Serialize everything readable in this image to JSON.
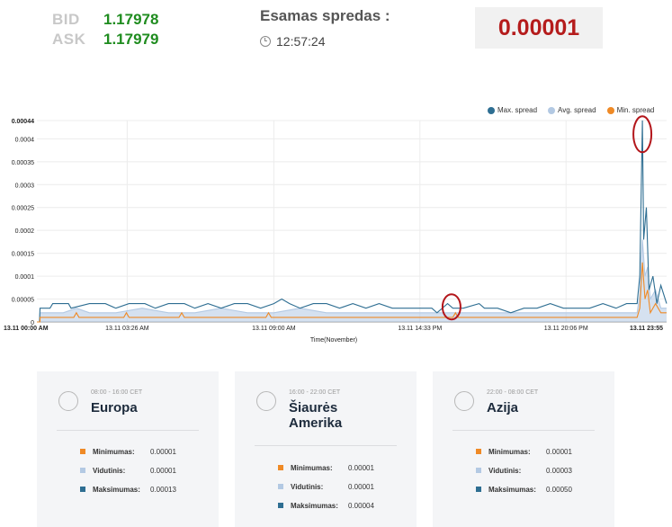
{
  "quotes": {
    "bid_label": "BID",
    "bid_value": "1.17978",
    "ask_label": "ASK",
    "ask_value": "1.17979"
  },
  "current_spread": {
    "title": "Esamas spredas :",
    "time": "12:57:24",
    "value": "0.00001",
    "icon": "clock-icon"
  },
  "colors": {
    "max": "#2e6e92",
    "avg": "#b3c9e3",
    "min": "#ef8a26",
    "highlight": "#b3161b"
  },
  "chart_data": {
    "type": "line",
    "xlabel": "Time(November)",
    "ylabel": "",
    "ylim": [
      0,
      0.00044
    ],
    "yticks": [
      "0.00044",
      "0.0004",
      "0.00035",
      "0.0003",
      "0.00025",
      "0.0002",
      "0.00015",
      "0.0001",
      "0.00005",
      "0"
    ],
    "xticks": [
      "13.11 00:00 AM",
      "13.11 03:26 AM",
      "13.11 09:00 AM",
      "13.11 14:33 PM",
      "13.11 20:06 PM",
      "13.11 23:55"
    ],
    "legend_position": "top-right",
    "grid": true,
    "x_range_hours": [
      0,
      23.92
    ],
    "series": [
      {
        "name": "Max. spread",
        "points": [
          [
            0,
            0
          ],
          [
            0.1,
            0
          ],
          [
            0.12,
            3e-05
          ],
          [
            0.5,
            3e-05
          ],
          [
            0.6,
            4e-05
          ],
          [
            1.2,
            4e-05
          ],
          [
            1.3,
            3e-05
          ],
          [
            2.0,
            4e-05
          ],
          [
            2.6,
            4e-05
          ],
          [
            3.0,
            3e-05
          ],
          [
            3.5,
            4e-05
          ],
          [
            4.1,
            4e-05
          ],
          [
            4.5,
            3e-05
          ],
          [
            5.0,
            4e-05
          ],
          [
            5.6,
            4e-05
          ],
          [
            6.0,
            3e-05
          ],
          [
            6.5,
            4e-05
          ],
          [
            7.0,
            3e-05
          ],
          [
            7.5,
            4e-05
          ],
          [
            8.0,
            4e-05
          ],
          [
            8.5,
            3e-05
          ],
          [
            9.0,
            4e-05
          ],
          [
            9.3,
            5e-05
          ],
          [
            9.6,
            4e-05
          ],
          [
            10.0,
            3e-05
          ],
          [
            10.5,
            4e-05
          ],
          [
            11.0,
            4e-05
          ],
          [
            11.5,
            3e-05
          ],
          [
            12.0,
            4e-05
          ],
          [
            12.5,
            3e-05
          ],
          [
            13.0,
            4e-05
          ],
          [
            13.5,
            3e-05
          ],
          [
            14.0,
            3e-05
          ],
          [
            14.5,
            3e-05
          ],
          [
            15.0,
            3e-05
          ],
          [
            15.2,
            2e-05
          ],
          [
            15.4,
            3e-05
          ],
          [
            15.6,
            4e-05
          ],
          [
            15.8,
            3e-05
          ],
          [
            16.2,
            3e-05
          ],
          [
            16.8,
            4e-05
          ],
          [
            17.0,
            3e-05
          ],
          [
            17.5,
            3e-05
          ],
          [
            18.0,
            2e-05
          ],
          [
            18.5,
            3e-05
          ],
          [
            19.0,
            3e-05
          ],
          [
            19.5,
            4e-05
          ],
          [
            20.0,
            3e-05
          ],
          [
            20.5,
            3e-05
          ],
          [
            21.0,
            3e-05
          ],
          [
            21.5,
            4e-05
          ],
          [
            22.0,
            3e-05
          ],
          [
            22.4,
            4e-05
          ],
          [
            22.8,
            4e-05
          ],
          [
            22.9,
            0.0001
          ],
          [
            23.0,
            0.00044
          ],
          [
            23.05,
            0.00018
          ],
          [
            23.15,
            0.00025
          ],
          [
            23.25,
            7e-05
          ],
          [
            23.4,
            0.0001
          ],
          [
            23.55,
            4e-05
          ],
          [
            23.7,
            8e-05
          ],
          [
            23.92,
            4e-05
          ]
        ]
      },
      {
        "name": "Avg. spread",
        "points": [
          [
            0,
            0
          ],
          [
            0.1,
            0
          ],
          [
            0.12,
            2e-05
          ],
          [
            1.0,
            2e-05
          ],
          [
            1.5,
            3e-05
          ],
          [
            2.0,
            2e-05
          ],
          [
            3.0,
            2e-05
          ],
          [
            4.0,
            3e-05
          ],
          [
            5.0,
            2e-05
          ],
          [
            6.0,
            2e-05
          ],
          [
            7.0,
            3e-05
          ],
          [
            8.0,
            2e-05
          ],
          [
            9.0,
            2e-05
          ],
          [
            10.0,
            3e-05
          ],
          [
            11.0,
            2e-05
          ],
          [
            12.0,
            2e-05
          ],
          [
            13.0,
            2e-05
          ],
          [
            14.0,
            2e-05
          ],
          [
            15.0,
            2e-05
          ],
          [
            16.0,
            2e-05
          ],
          [
            17.0,
            2e-05
          ],
          [
            18.0,
            2e-05
          ],
          [
            19.0,
            2e-05
          ],
          [
            20.0,
            2e-05
          ],
          [
            21.0,
            2e-05
          ],
          [
            22.0,
            2e-05
          ],
          [
            22.8,
            2e-05
          ],
          [
            22.9,
            6e-05
          ],
          [
            23.0,
            0.00018
          ],
          [
            23.1,
            0.0001
          ],
          [
            23.2,
            0.00012
          ],
          [
            23.3,
            5e-05
          ],
          [
            23.5,
            7e-05
          ],
          [
            23.7,
            3e-05
          ],
          [
            23.92,
            3e-05
          ]
        ]
      },
      {
        "name": "Min. spread",
        "points": [
          [
            0,
            0
          ],
          [
            0.12,
            0
          ],
          [
            0.12,
            1e-05
          ],
          [
            1.4,
            1e-05
          ],
          [
            1.5,
            2e-05
          ],
          [
            1.6,
            1e-05
          ],
          [
            3.3,
            1e-05
          ],
          [
            3.4,
            2e-05
          ],
          [
            3.5,
            1e-05
          ],
          [
            5.4,
            1e-05
          ],
          [
            5.5,
            2e-05
          ],
          [
            5.6,
            1e-05
          ],
          [
            8.7,
            1e-05
          ],
          [
            8.8,
            2e-05
          ],
          [
            8.9,
            1e-05
          ],
          [
            15.8,
            1e-05
          ],
          [
            15.9,
            2e-05
          ],
          [
            16.0,
            1e-05
          ],
          [
            22.8,
            1e-05
          ],
          [
            22.9,
            3e-05
          ],
          [
            23.0,
            0.00013
          ],
          [
            23.1,
            5e-05
          ],
          [
            23.2,
            7e-05
          ],
          [
            23.3,
            2e-05
          ],
          [
            23.5,
            4e-05
          ],
          [
            23.7,
            2e-05
          ],
          [
            23.92,
            2e-05
          ]
        ]
      }
    ],
    "highlights": [
      {
        "x": 15.75,
        "y": 3.3e-05
      },
      {
        "x": 23.0,
        "y": 0.00041
      }
    ]
  },
  "sessions": [
    {
      "hours": "08:00 - 16:00 CET",
      "title": "Europa",
      "icon": "europe-region-icon",
      "rows": [
        {
          "label": "Minimumas:",
          "value": "0.00001"
        },
        {
          "label": "Vidutinis:",
          "value": "0.00001"
        },
        {
          "label": "Maksimumas:",
          "value": "0.00013"
        }
      ]
    },
    {
      "hours": "16:00 - 22:00 CET",
      "title": "Šiaurės Amerika",
      "icon": "america-region-icon",
      "rows": [
        {
          "label": "Minimumas:",
          "value": "0.00001"
        },
        {
          "label": "Vidutinis:",
          "value": "0.00001"
        },
        {
          "label": "Maksimumas:",
          "value": "0.00004"
        }
      ]
    },
    {
      "hours": "22:00 - 08:00 CET",
      "title": "Azija",
      "icon": "asia-region-icon",
      "rows": [
        {
          "label": "Minimumas:",
          "value": "0.00001"
        },
        {
          "label": "Vidutinis:",
          "value": "0.00003"
        },
        {
          "label": "Maksimumas:",
          "value": "0.00050"
        }
      ]
    }
  ]
}
